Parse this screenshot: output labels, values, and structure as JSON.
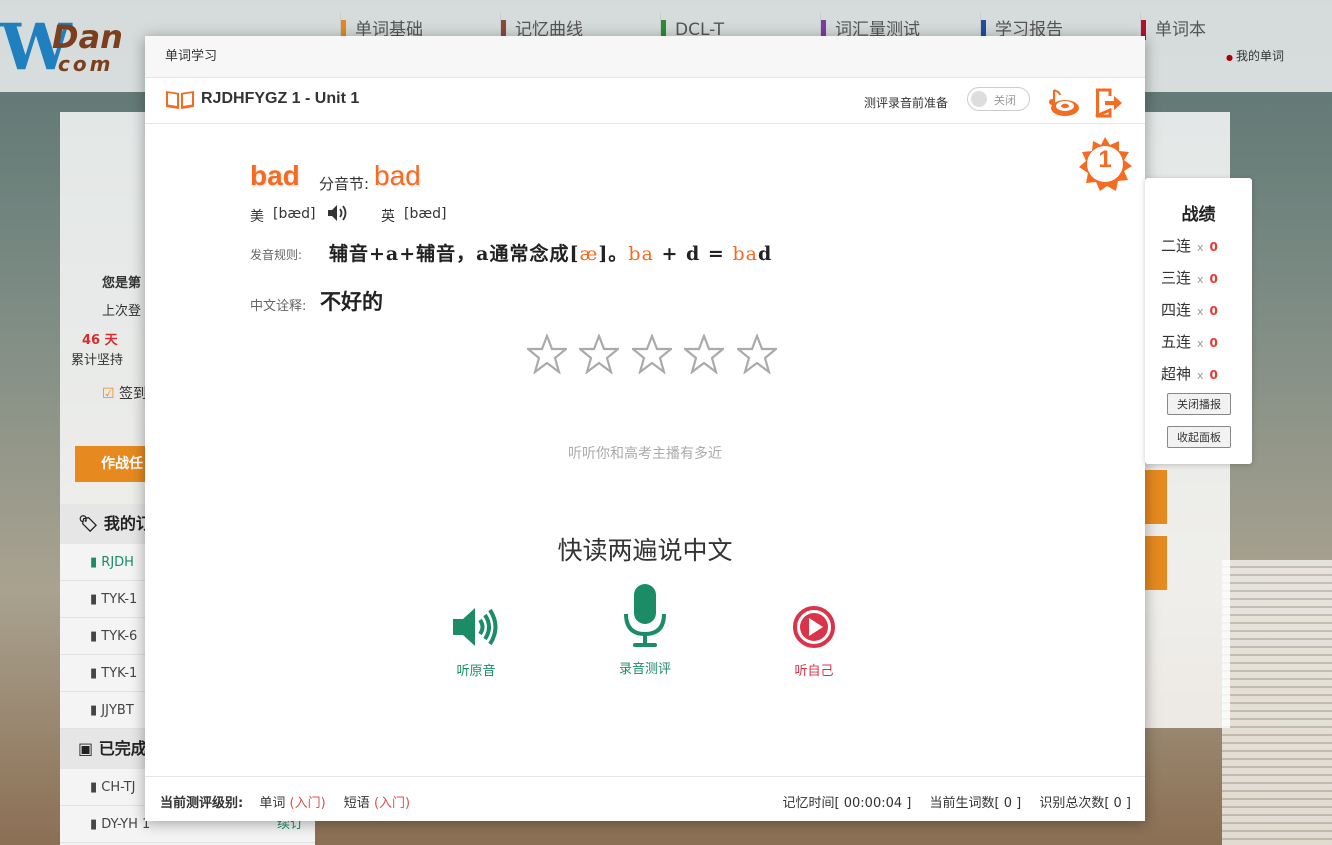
{
  "background": {
    "nav": [
      "单词基础",
      "记忆曲线",
      "DCL-T",
      "词汇量测试",
      "学习报告",
      "单词本"
    ],
    "nav_sub": "我的单词",
    "logo_top": "Dan",
    "logo_bottom": "com",
    "left_lines": [
      "您是第",
      "上次登"
    ],
    "streak_days": "46 天",
    "streak_label": "累计坚持",
    "signin": "签到",
    "battle_btn": "作战任",
    "my_books": "我的订",
    "books": [
      "RJDH",
      "TYK-1",
      "TYK-6",
      "TYK-1",
      "JJYBT"
    ],
    "finished": "已完成",
    "finished_books": [
      "CH-TJ",
      "DY-YH 1"
    ],
    "renew": "续订"
  },
  "modal": {
    "header_title": "单词学习",
    "unit_title": "RJDHFYGZ 1 - Unit 1",
    "prep_label": "测评录音前准备",
    "toggle_label": "关闭",
    "rank": "1",
    "word": "bad",
    "syllable_label": "分音节:",
    "syllable_value": "bad",
    "us_label": "美",
    "us_phonetic": "[bæd]",
    "uk_label": "英",
    "uk_phonetic": "[bæd]",
    "rule_label": "发音规则:",
    "rule_prefix": "辅音+a+辅音，a通常念成[",
    "rule_ipa": "æ",
    "rule_mid": "]。",
    "rule_ba": "ba",
    "rule_plus": "+",
    "rule_d": "d",
    "rule_eq": "=",
    "rule_res_a": "ba",
    "rule_res_b": "d",
    "cn_label": "中文诠释:",
    "cn_value": "不好的",
    "stars_filled": 0,
    "stars_total": 5,
    "hint": "听听你和高考主播有多近",
    "prompt": "快读两遍说中文",
    "actions": {
      "listen": "听原音",
      "record": "录音测评",
      "self": "听自己"
    },
    "footer": {
      "level_label": "当前测评级别:",
      "word_label": "单词",
      "word_level": "(入门)",
      "phrase_label": "短语",
      "phrase_level": "(入门)",
      "memory_time": "记忆时间[ 00:00:04 ]",
      "new_words": "当前生词数[ 0 ]",
      "total_recognized": "识别总次数[ 0 ]"
    }
  },
  "score_panel": {
    "title": "战绩",
    "rows": [
      {
        "label": "二连",
        "x": "x",
        "count": "0"
      },
      {
        "label": "三连",
        "x": "x",
        "count": "0"
      },
      {
        "label": "四连",
        "x": "x",
        "count": "0"
      },
      {
        "label": "五连",
        "x": "x",
        "count": "0"
      },
      {
        "label": "超神",
        "x": "x",
        "count": "0"
      }
    ],
    "close_broadcast": "关闭播报",
    "collapse_panel": "收起面板"
  },
  "colors": {
    "accent": "#f36c21",
    "green": "#1c8c66",
    "red": "#d9344a"
  }
}
